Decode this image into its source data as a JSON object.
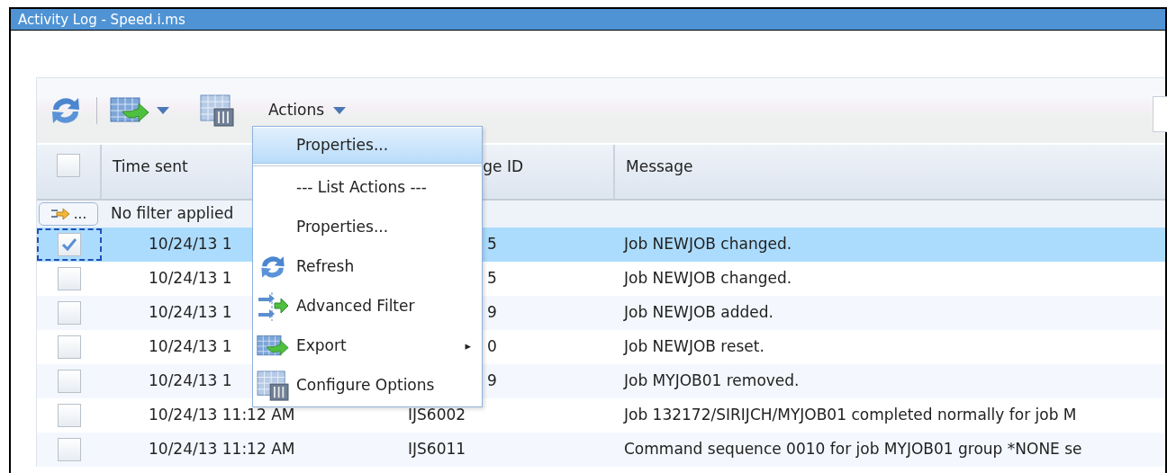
{
  "window": {
    "title": "Activity Log - Speed.i.ms"
  },
  "toolbar": {
    "actions_label": "Actions"
  },
  "menu": {
    "items": [
      {
        "kind": "item",
        "label": "Properties...",
        "selected": true
      },
      {
        "kind": "separator"
      },
      {
        "kind": "heading",
        "label": "--- List Actions ---",
        "selected": false
      },
      {
        "kind": "item",
        "label": "Properties...",
        "selected": false
      },
      {
        "kind": "refresh",
        "label": "Refresh",
        "selected": false
      },
      {
        "kind": "filter",
        "label": "Advanced Filter",
        "selected": false
      },
      {
        "kind": "export",
        "label": "Export",
        "selected": false,
        "submenu": "▸"
      },
      {
        "kind": "configure",
        "label": "Configure Options",
        "selected": false
      }
    ]
  },
  "table": {
    "columns": [
      "Time sent",
      "ge ID",
      "Message"
    ],
    "select_all_checked": false,
    "filter": {
      "button": "...",
      "text": "No filter applied"
    },
    "rows": [
      {
        "time": "10/24/13 1",
        "message_id": "5",
        "message": "Job NEWJOB changed.",
        "checked": true,
        "selected": true,
        "focused": true
      },
      {
        "time": "10/24/13 1",
        "message_id": "5",
        "message": "Job NEWJOB changed.",
        "checked": false,
        "selected": false,
        "focused": false
      },
      {
        "time": "10/24/13 1",
        "message_id": "9",
        "message": "Job NEWJOB added.",
        "checked": false,
        "selected": false,
        "focused": false
      },
      {
        "time": "10/24/13 1",
        "message_id": "0",
        "message": "Job NEWJOB reset.",
        "checked": false,
        "selected": false,
        "focused": false
      },
      {
        "time": "10/24/13 1",
        "message_id": "9",
        "message": "Job MYJOB01 removed.",
        "checked": false,
        "selected": false,
        "focused": false
      },
      {
        "time": "10/24/13 11:12 AM",
        "message_id": "IJS6002",
        "message": "Job 132172/SIRIJCH/MYJOB01 completed normally for job M",
        "checked": false,
        "selected": false,
        "focused": false
      },
      {
        "time": "10/24/13 11:12 AM",
        "message_id": "IJS6011",
        "message": "Command sequence 0010 for job MYJOB01 group *NONE se",
        "checked": false,
        "selected": false,
        "focused": false
      }
    ]
  }
}
